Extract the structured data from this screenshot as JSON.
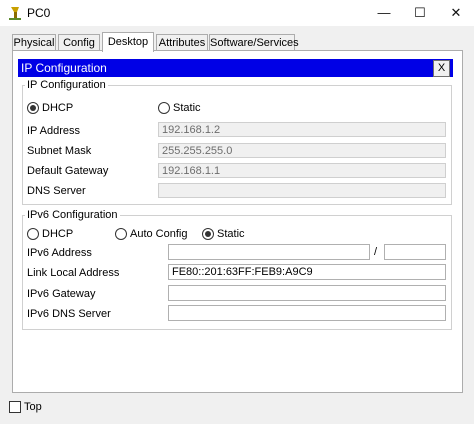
{
  "window": {
    "title": "PC0",
    "minimize": "—",
    "maximize": "☐",
    "close": "✕"
  },
  "tabs": [
    "Physical",
    "Config",
    "Desktop",
    "Attributes",
    "Software/Services"
  ],
  "ip_config": {
    "header": "IP Configuration",
    "close": "X",
    "group_title": "IP Configuration",
    "dhcp": "DHCP",
    "static": "Static",
    "ip_address_label": "IP Address",
    "ip_address": "192.168.1.2",
    "subnet_label": "Subnet Mask",
    "subnet": "255.255.255.0",
    "gateway_label": "Default Gateway",
    "gateway": "192.168.1.1",
    "dns_label": "DNS Server",
    "dns": ""
  },
  "ipv6": {
    "group_title": "IPv6 Configuration",
    "dhcp": "DHCP",
    "auto": "Auto Config",
    "static": "Static",
    "address_label": "IPv6 Address",
    "address": "",
    "slash": "/",
    "prefix": "",
    "link_local_label": "Link Local Address",
    "link_local": "FE80::201:63FF:FEB9:A9C9",
    "gateway_label": "IPv6 Gateway",
    "gateway": "",
    "dns_label": "IPv6 DNS Server",
    "dns": ""
  },
  "footer": {
    "top_label": "Top"
  }
}
